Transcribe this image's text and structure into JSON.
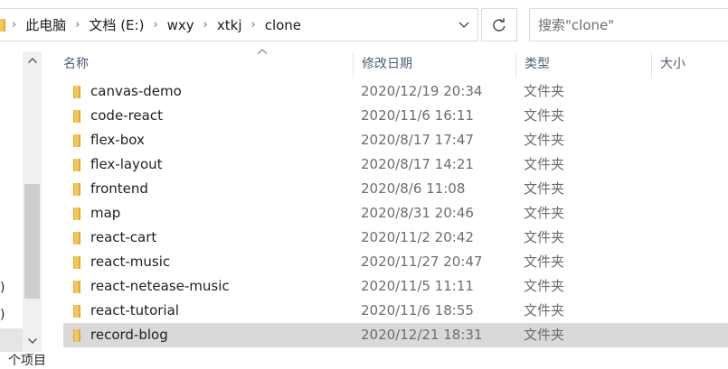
{
  "address_bar": {
    "breadcrumbs": [
      "此电脑",
      "文档 (E:)",
      "wxy",
      "xtkj",
      "clone"
    ]
  },
  "search": {
    "placeholder": "搜索\"clone\""
  },
  "nav": {
    "fragments": [
      ")",
      ")"
    ],
    "status_fragment": "个项目"
  },
  "columns": {
    "name": "名称",
    "date": "修改日期",
    "type": "类型",
    "size": "大小"
  },
  "files": [
    {
      "name": "canvas-demo",
      "date": "2020/12/19 20:34",
      "type": "文件夹"
    },
    {
      "name": "code-react",
      "date": "2020/11/6 16:11",
      "type": "文件夹"
    },
    {
      "name": "flex-box",
      "date": "2020/8/17 17:47",
      "type": "文件夹"
    },
    {
      "name": "flex-layout",
      "date": "2020/8/17 14:21",
      "type": "文件夹"
    },
    {
      "name": "frontend",
      "date": "2020/8/6 11:08",
      "type": "文件夹"
    },
    {
      "name": "map",
      "date": "2020/8/31 20:46",
      "type": "文件夹"
    },
    {
      "name": "react-cart",
      "date": "2020/11/2 20:42",
      "type": "文件夹"
    },
    {
      "name": "react-music",
      "date": "2020/11/27 20:47",
      "type": "文件夹"
    },
    {
      "name": "react-netease-music",
      "date": "2020/11/5 11:11",
      "type": "文件夹"
    },
    {
      "name": "react-tutorial",
      "date": "2020/11/6 18:55",
      "type": "文件夹"
    },
    {
      "name": "record-blog",
      "date": "2020/12/21 18:31",
      "type": "文件夹",
      "selected": true
    }
  ],
  "colors": {
    "folder": "#f5c758",
    "folder_dark": "#dcab3a",
    "header_text": "#4c607a",
    "selection": "#d9d9d9"
  }
}
